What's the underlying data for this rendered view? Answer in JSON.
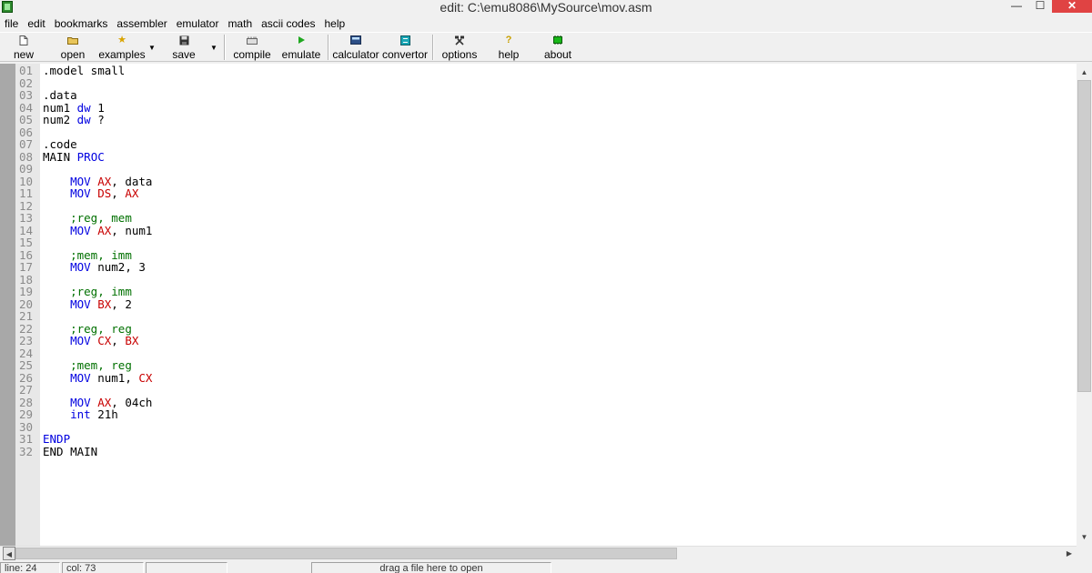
{
  "window": {
    "title": "edit: C:\\emu8086\\MySource\\mov.asm",
    "controls": {
      "minimize": "—",
      "maximize": "☐",
      "close": "✕"
    }
  },
  "menu": [
    "file",
    "edit",
    "bookmarks",
    "assembler",
    "emulator",
    "math",
    "ascii codes",
    "help"
  ],
  "toolbar": {
    "new": "new",
    "open": "open",
    "examples": "examples",
    "save": "save",
    "compile": "compile",
    "emulate": "emulate",
    "calculator": "calculator",
    "convertor": "convertor",
    "options": "options",
    "help": "help",
    "about": "about"
  },
  "icons": {
    "new": "document-icon",
    "open": "folder-icon",
    "examples": "star-icon",
    "save": "floppy-disk-icon",
    "compile": "compile-icon",
    "emulate": "play-icon",
    "calculator": "calculator-icon",
    "convertor": "convertor-icon",
    "options": "tools-icon",
    "help": "question-bulb-icon",
    "about": "chip-icon"
  },
  "colors": {
    "keyword": "#0000e0",
    "register": "#c80000",
    "comment": "#007000",
    "plain": "#000000",
    "line_number": "#8a8a8a",
    "emulate_icon": "#1fa81f",
    "close_button": "#e04343"
  },
  "code": [
    {
      "n": "01",
      "parts": [
        {
          "t": ".model small",
          "c": "plain"
        }
      ]
    },
    {
      "n": "02",
      "parts": []
    },
    {
      "n": "03",
      "parts": [
        {
          "t": ".data",
          "c": "plain"
        }
      ]
    },
    {
      "n": "04",
      "parts": [
        {
          "t": "num1 ",
          "c": "plain"
        },
        {
          "t": "dw",
          "c": "kw"
        },
        {
          "t": " 1",
          "c": "plain"
        }
      ]
    },
    {
      "n": "05",
      "parts": [
        {
          "t": "num2 ",
          "c": "plain"
        },
        {
          "t": "dw",
          "c": "kw"
        },
        {
          "t": " ?",
          "c": "plain"
        }
      ]
    },
    {
      "n": "06",
      "parts": []
    },
    {
      "n": "07",
      "parts": [
        {
          "t": ".code",
          "c": "plain"
        }
      ]
    },
    {
      "n": "08",
      "parts": [
        {
          "t": "MAIN ",
          "c": "plain"
        },
        {
          "t": "PROC",
          "c": "kw"
        }
      ]
    },
    {
      "n": "09",
      "parts": []
    },
    {
      "n": "10",
      "parts": [
        {
          "t": "    ",
          "c": "plain"
        },
        {
          "t": "MOV",
          "c": "kw"
        },
        {
          "t": " ",
          "c": "plain"
        },
        {
          "t": "AX",
          "c": "reg"
        },
        {
          "t": ", data",
          "c": "plain"
        }
      ]
    },
    {
      "n": "11",
      "parts": [
        {
          "t": "    ",
          "c": "plain"
        },
        {
          "t": "MOV",
          "c": "kw"
        },
        {
          "t": " ",
          "c": "plain"
        },
        {
          "t": "DS",
          "c": "reg"
        },
        {
          "t": ", ",
          "c": "plain"
        },
        {
          "t": "AX",
          "c": "reg"
        }
      ]
    },
    {
      "n": "12",
      "parts": []
    },
    {
      "n": "13",
      "parts": [
        {
          "t": "    ",
          "c": "plain"
        },
        {
          "t": ";reg, mem",
          "c": "cm"
        }
      ]
    },
    {
      "n": "14",
      "parts": [
        {
          "t": "    ",
          "c": "plain"
        },
        {
          "t": "MOV",
          "c": "kw"
        },
        {
          "t": " ",
          "c": "plain"
        },
        {
          "t": "AX",
          "c": "reg"
        },
        {
          "t": ", num1",
          "c": "plain"
        }
      ]
    },
    {
      "n": "15",
      "parts": []
    },
    {
      "n": "16",
      "parts": [
        {
          "t": "    ",
          "c": "plain"
        },
        {
          "t": ";mem, imm",
          "c": "cm"
        }
      ]
    },
    {
      "n": "17",
      "parts": [
        {
          "t": "    ",
          "c": "plain"
        },
        {
          "t": "MOV",
          "c": "kw"
        },
        {
          "t": " num2, 3",
          "c": "plain"
        }
      ]
    },
    {
      "n": "18",
      "parts": []
    },
    {
      "n": "19",
      "parts": [
        {
          "t": "    ",
          "c": "plain"
        },
        {
          "t": ";reg, imm",
          "c": "cm"
        }
      ]
    },
    {
      "n": "20",
      "parts": [
        {
          "t": "    ",
          "c": "plain"
        },
        {
          "t": "MOV",
          "c": "kw"
        },
        {
          "t": " ",
          "c": "plain"
        },
        {
          "t": "BX",
          "c": "reg"
        },
        {
          "t": ", 2",
          "c": "plain"
        }
      ]
    },
    {
      "n": "21",
      "parts": []
    },
    {
      "n": "22",
      "parts": [
        {
          "t": "    ",
          "c": "plain"
        },
        {
          "t": ";reg, reg",
          "c": "cm"
        }
      ]
    },
    {
      "n": "23",
      "parts": [
        {
          "t": "    ",
          "c": "plain"
        },
        {
          "t": "MOV",
          "c": "kw"
        },
        {
          "t": " ",
          "c": "plain"
        },
        {
          "t": "CX",
          "c": "reg"
        },
        {
          "t": ", ",
          "c": "plain"
        },
        {
          "t": "BX",
          "c": "reg"
        }
      ]
    },
    {
      "n": "24",
      "parts": []
    },
    {
      "n": "25",
      "parts": [
        {
          "t": "    ",
          "c": "plain"
        },
        {
          "t": ";mem, reg",
          "c": "cm"
        }
      ]
    },
    {
      "n": "26",
      "parts": [
        {
          "t": "    ",
          "c": "plain"
        },
        {
          "t": "MOV",
          "c": "kw"
        },
        {
          "t": " num1, ",
          "c": "plain"
        },
        {
          "t": "CX",
          "c": "reg"
        }
      ]
    },
    {
      "n": "27",
      "parts": []
    },
    {
      "n": "28",
      "parts": [
        {
          "t": "    ",
          "c": "plain"
        },
        {
          "t": "MOV",
          "c": "kw"
        },
        {
          "t": " ",
          "c": "plain"
        },
        {
          "t": "AX",
          "c": "reg"
        },
        {
          "t": ", 04ch",
          "c": "plain"
        }
      ]
    },
    {
      "n": "29",
      "parts": [
        {
          "t": "    ",
          "c": "plain"
        },
        {
          "t": "int",
          "c": "kw"
        },
        {
          "t": " 21h",
          "c": "plain"
        }
      ]
    },
    {
      "n": "30",
      "parts": []
    },
    {
      "n": "31",
      "parts": [
        {
          "t": "ENDP",
          "c": "kw"
        }
      ]
    },
    {
      "n": "32",
      "parts": [
        {
          "t": "END MAIN",
          "c": "plain"
        }
      ]
    }
  ],
  "status": {
    "line": "line: 24",
    "col": "col: 73",
    "blank": "",
    "hint": "drag a file here to open"
  }
}
